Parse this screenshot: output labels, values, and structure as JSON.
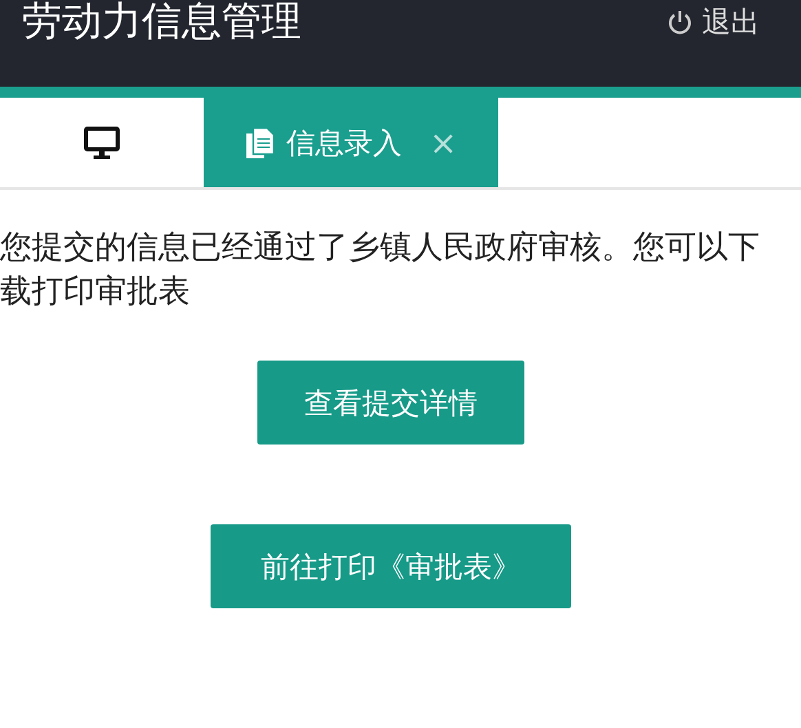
{
  "header": {
    "title": "劳动力信息管理",
    "logout": "退出"
  },
  "tabs": [
    {
      "kind": "home",
      "selected": false
    },
    {
      "kind": "page",
      "label": "信息录入",
      "close": "×",
      "selected": true
    }
  ],
  "message": "您提交的信息已经通过了乡镇人民政府审核。您可以下载打印审批表",
  "buttons": [
    "查看提交详情",
    "前往打印《审批表》"
  ]
}
